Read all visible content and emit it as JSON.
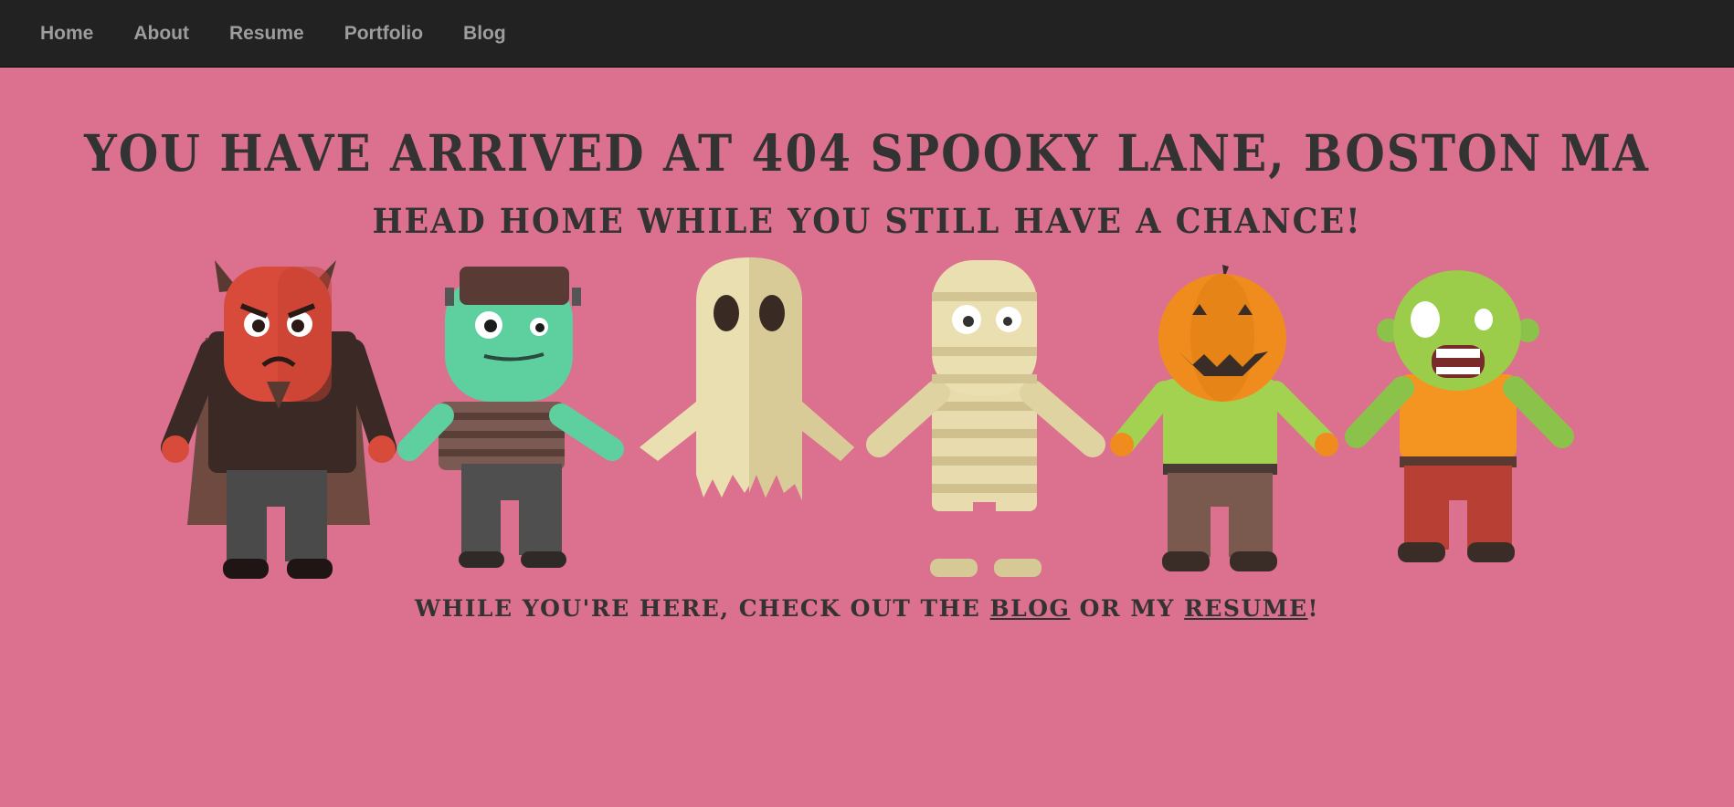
{
  "nav": {
    "items": [
      {
        "label": "Home"
      },
      {
        "label": "About"
      },
      {
        "label": "Resume"
      },
      {
        "label": "Portfolio"
      },
      {
        "label": "Blog"
      }
    ]
  },
  "main": {
    "title": "YOU HAVE ARRIVED AT 404 SPOOKY LANE, BOSTON MA",
    "subtitle": "HEAD HOME WHILE YOU STILL HAVE A CHANCE!",
    "footer": {
      "prefix": "WHILE YOU'RE HERE, CHECK OUT THE ",
      "blog_link": "BLOG",
      "middle": " OR MY ",
      "resume_link": "RESUME",
      "suffix": "!"
    }
  },
  "colors": {
    "background": "#db708f",
    "navbar": "#222222",
    "nav_text": "#9d9d9d",
    "heading_text": "#333333"
  },
  "illustration": {
    "characters": [
      "devil",
      "frankenstein-monster",
      "ghost",
      "mummy",
      "pumpkin-head",
      "zombie"
    ]
  }
}
